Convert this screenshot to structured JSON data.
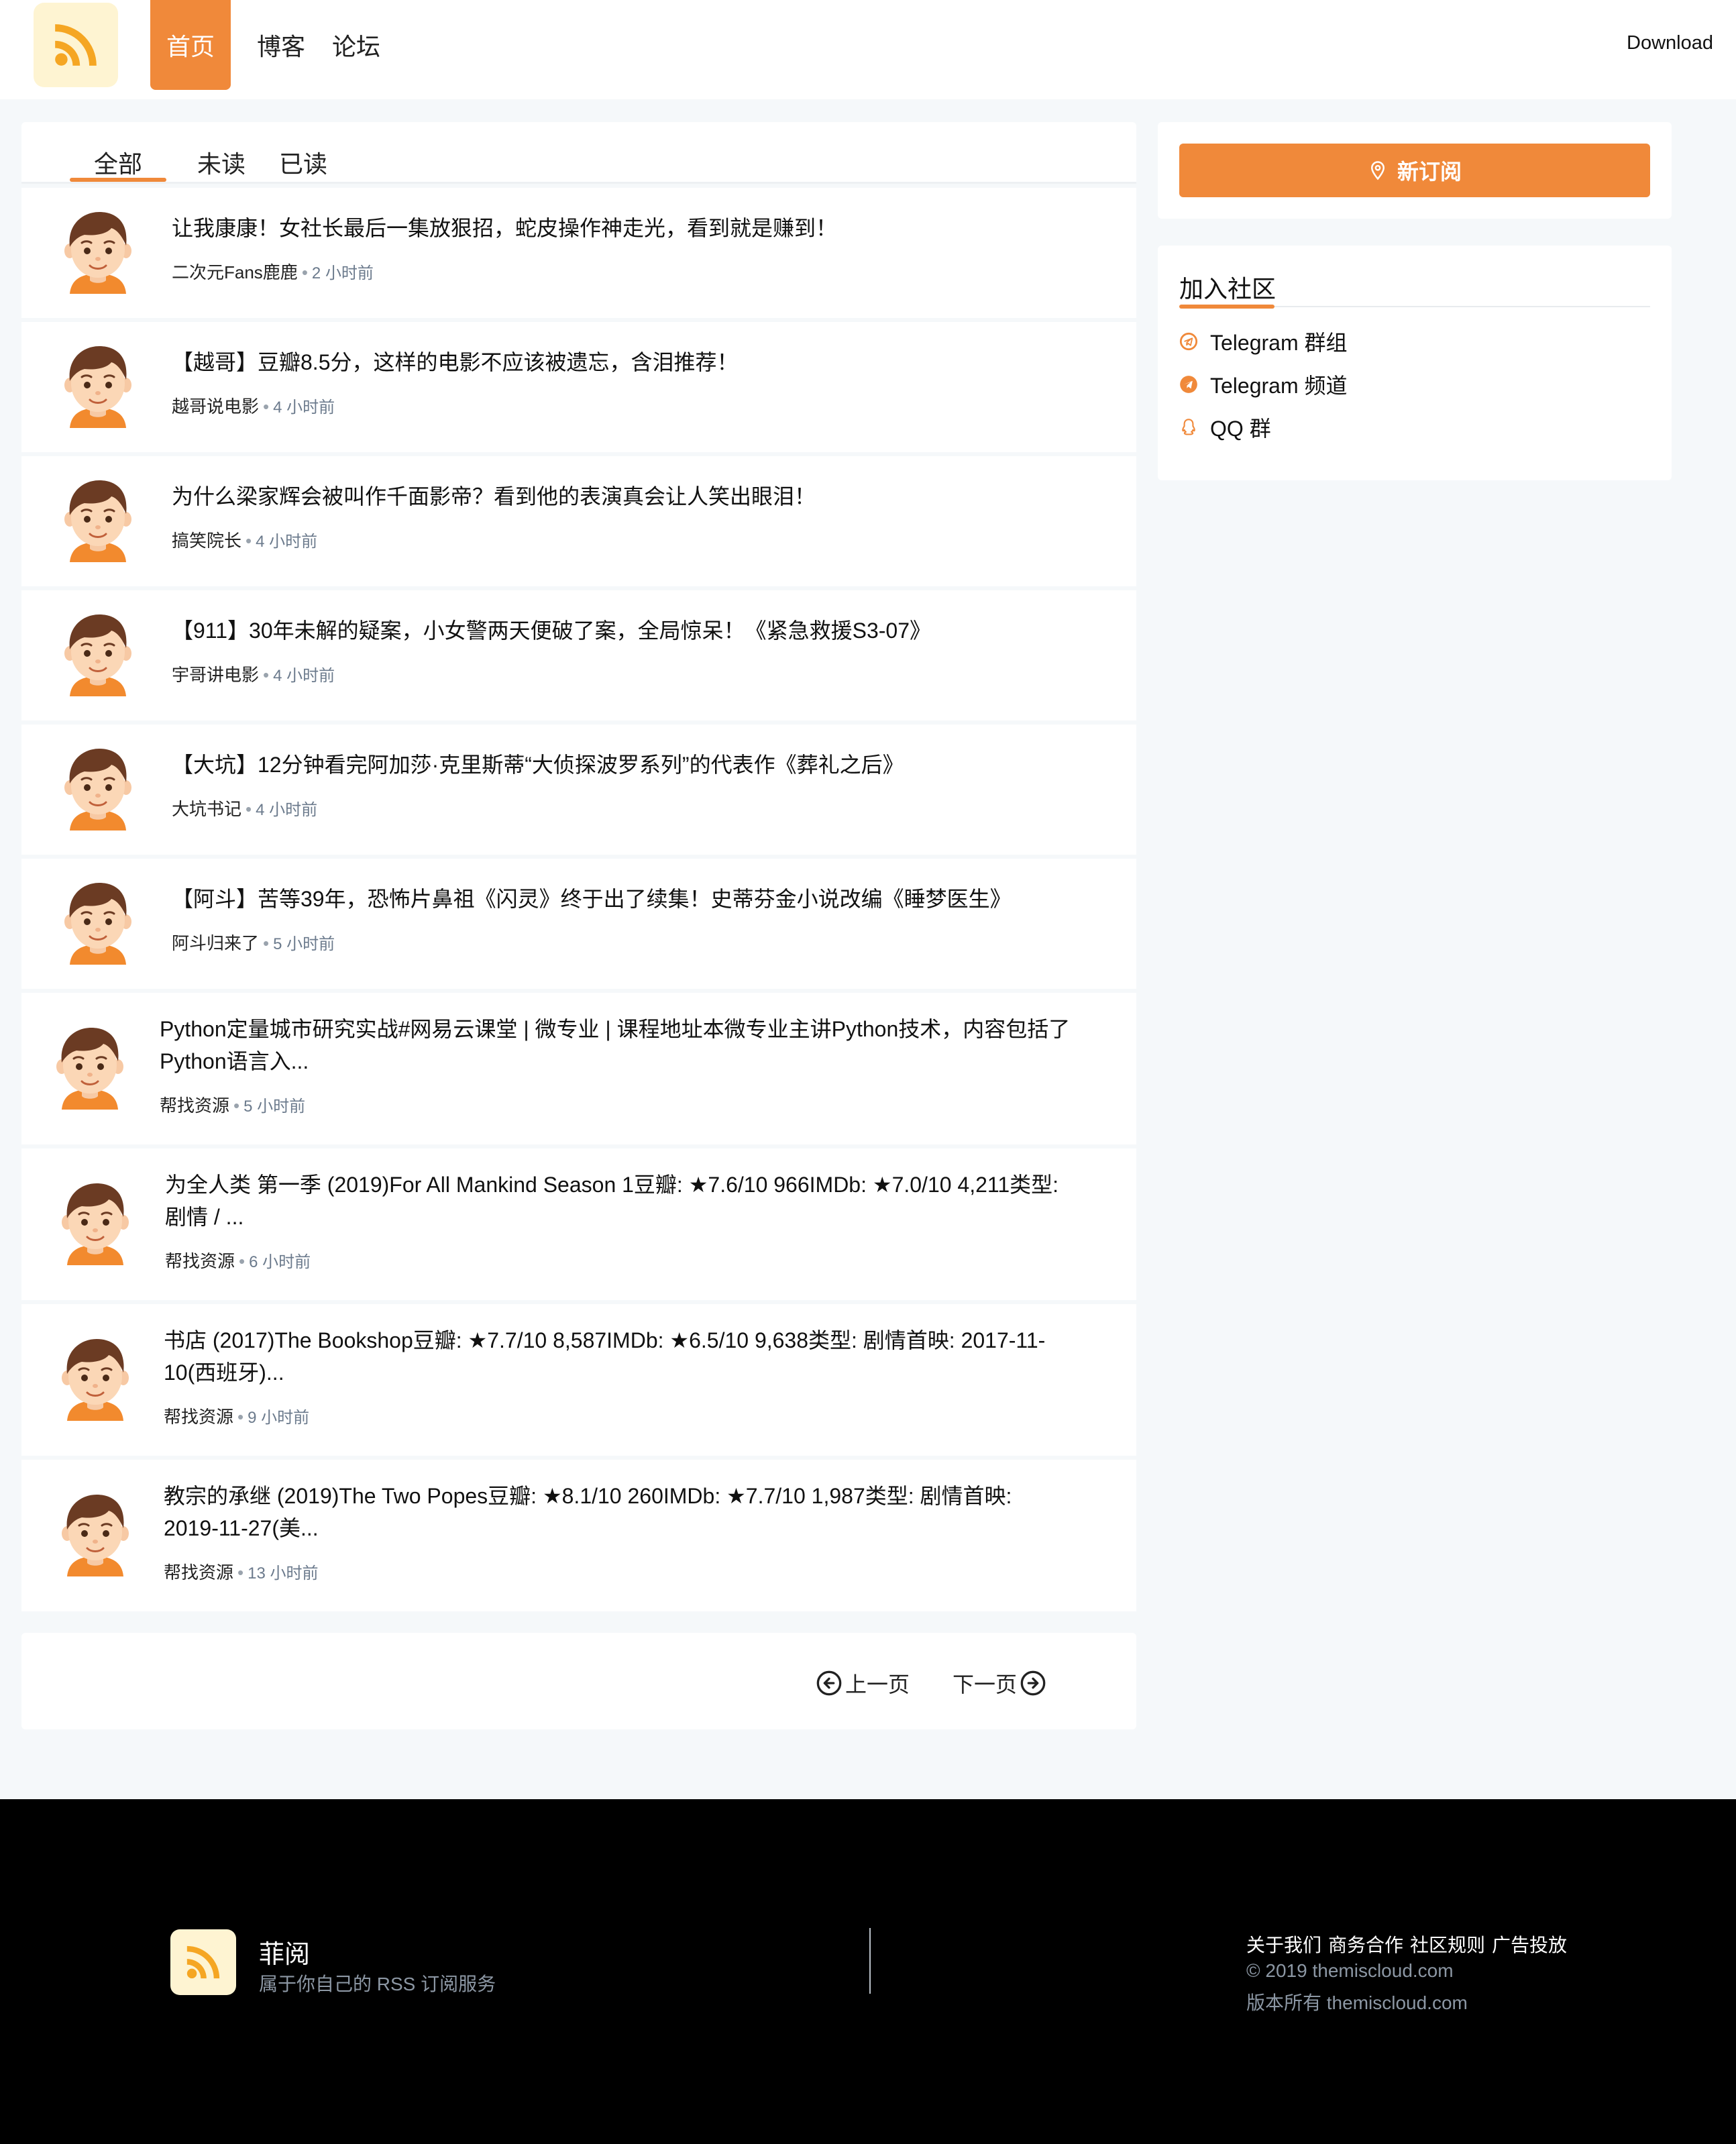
{
  "header": {
    "nav": [
      "首页",
      "博客",
      "论坛"
    ],
    "download": "Download"
  },
  "tabs": [
    "全部",
    "未读",
    "已读"
  ],
  "items": [
    {
      "title": "让我康康！女社长最后一集放狠招，蛇皮操作神走光，看到就是赚到！",
      "author": "二次元Fans鹿鹿",
      "time": "2 小时前"
    },
    {
      "title": "【越哥】豆瓣8.5分，这样的电影不应该被遗忘，含泪推荐！",
      "author": "越哥说电影",
      "time": "4 小时前"
    },
    {
      "title": "为什么梁家辉会被叫作千面影帝？看到他的表演真会让人笑出眼泪！",
      "author": "搞笑院长",
      "time": "4 小时前"
    },
    {
      "title": "【911】30年未解的疑案，小女警两天便破了案，全局惊呆！《紧急救援S3-07》",
      "author": "宇哥讲电影",
      "time": "4 小时前"
    },
    {
      "title": "【大坑】12分钟看完阿加莎·克里斯蒂“大侦探波罗系列”的代表作《葬礼之后》",
      "author": "大坑书记",
      "time": "4 小时前"
    },
    {
      "title": "【阿斗】苦等39年，恐怖片鼻祖《闪灵》终于出了续集！史蒂芬金小说改编《睡梦医生》",
      "author": "阿斗归来了",
      "time": "5 小时前"
    },
    {
      "title_lines": [
        "Python定量城市研究实战#网易云课堂 | 微专业 | 课程地址本微专业主讲Python技术，内容包括了",
        "Python语言入..."
      ],
      "author": "帮找资源",
      "time": "5 小时前"
    },
    {
      "title_lines": [
        "为全人类 第一季 (2019)For All Mankind Season 1豆瓣: ★7.6/10 966IMDb: ★7.0/10 4,211类型:",
        "剧情 / ..."
      ],
      "author": "帮找资源",
      "time": "6 小时前"
    },
    {
      "title_lines": [
        "书店 (2017)The Bookshop豆瓣: ★7.7/10 8,587IMDb: ★6.5/10 9,638类型: 剧情首映: 2017-11-",
        "10(西班牙)..."
      ],
      "author": "帮找资源",
      "time": "9 小时前"
    },
    {
      "title_lines": [
        "教宗的承继 (2019)The Two Popes豆瓣: ★8.1/10 260IMDb: ★7.7/10 1,987类型: 剧情首映:",
        "2019-11-27(美..."
      ],
      "author": "帮找资源",
      "time": "13 小时前"
    }
  ],
  "pager": {
    "prev": "上一页",
    "next": "下一页"
  },
  "sidebar": {
    "subscribe": "新订阅",
    "community_title": "加入社区",
    "links": [
      "Telegram 群组",
      "Telegram 频道",
      "QQ 群"
    ]
  },
  "footer": {
    "name": "菲阅",
    "slogan": "属于你自己的 RSS 订阅服务",
    "links": [
      "关于我们",
      "商务合作",
      "社区规则",
      "广告投放"
    ],
    "copyright": "© 2019 themiscloud.com",
    "rights": "版本所有 themiscloud.com"
  },
  "colors": {
    "accent": "#f0893a",
    "logo_bg": "#fef4d2",
    "footer_bg": "#000000"
  }
}
